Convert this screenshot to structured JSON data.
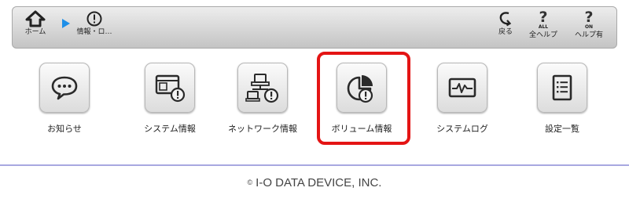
{
  "toolbar": {
    "home_label": "ホーム",
    "info_label": "情報・ロ…",
    "back_label": "戻る",
    "all_help_label": "全ヘルプ",
    "all_help_mark": "?",
    "all_help_sub": "ALL",
    "help_on_label": "ヘルプ有",
    "help_on_mark": "?",
    "help_on_sub": "ON",
    "arrow_color": "#1e8fe8"
  },
  "tiles": [
    {
      "label": "お知らせ",
      "icon": "speech-bubble-icon"
    },
    {
      "label": "システム情報",
      "icon": "system-info-icon"
    },
    {
      "label": "ネットワーク情報",
      "icon": "network-info-icon"
    },
    {
      "label": "ボリューム情報",
      "icon": "volume-info-icon"
    },
    {
      "label": "システムログ",
      "icon": "system-log-icon"
    },
    {
      "label": "設定一覧",
      "icon": "settings-list-icon"
    }
  ],
  "highlight_color": "#e41414",
  "footer": {
    "copyright_symbol": "©",
    "text": "I-O DATA DEVICE, INC."
  }
}
